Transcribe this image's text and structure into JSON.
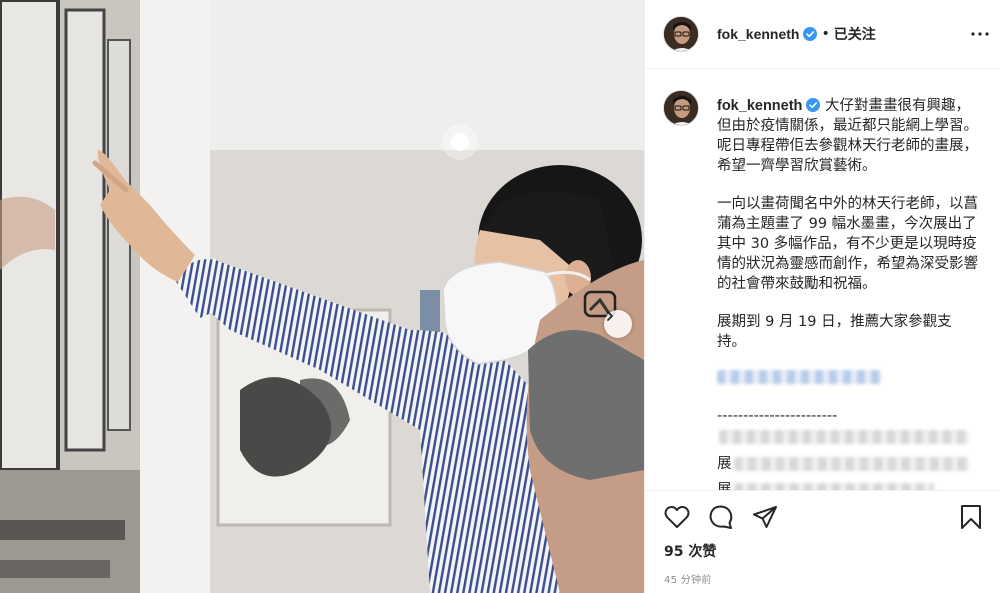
{
  "post": {
    "username": "fok_kenneth",
    "verified": true,
    "follow_status": "已关注",
    "caption_paragraphs": [
      "大仔對畫畫很有興趣，但由於疫情關係，最近都只能網上學習。呢日專程帶佢去參觀林天行老師的畫展，希望一齊學習欣賞藝術。",
      "一向以畫荷聞名中外的林天行老師，以菖蒲為主題畫了 99 幅水墨畫，今次展出了其中 30 多幅作品，有不少更是以現時疫情的狀況為靈感而創作，希望為深受影響的社會帶來鼓勵和祝福。",
      "展期到 9 月 19 日，推薦大家參觀支持。"
    ],
    "separator": "-----------------------",
    "blurred_line_prefix_1": "展",
    "blurred_line_prefix_2": "展",
    "likes": "95 次赞",
    "timestamp": "45 分钟前"
  },
  "icons": {
    "verified": "verified-badge-icon",
    "more": "more-options-icon",
    "like": "heart-icon",
    "comment": "comment-icon",
    "share": "share-icon",
    "save": "bookmark-icon",
    "next": "chevron-right-icon"
  },
  "colors": {
    "verified_blue": "#3897f0",
    "text": "#262626",
    "muted": "#8e8e8e",
    "border": "#efefef"
  }
}
